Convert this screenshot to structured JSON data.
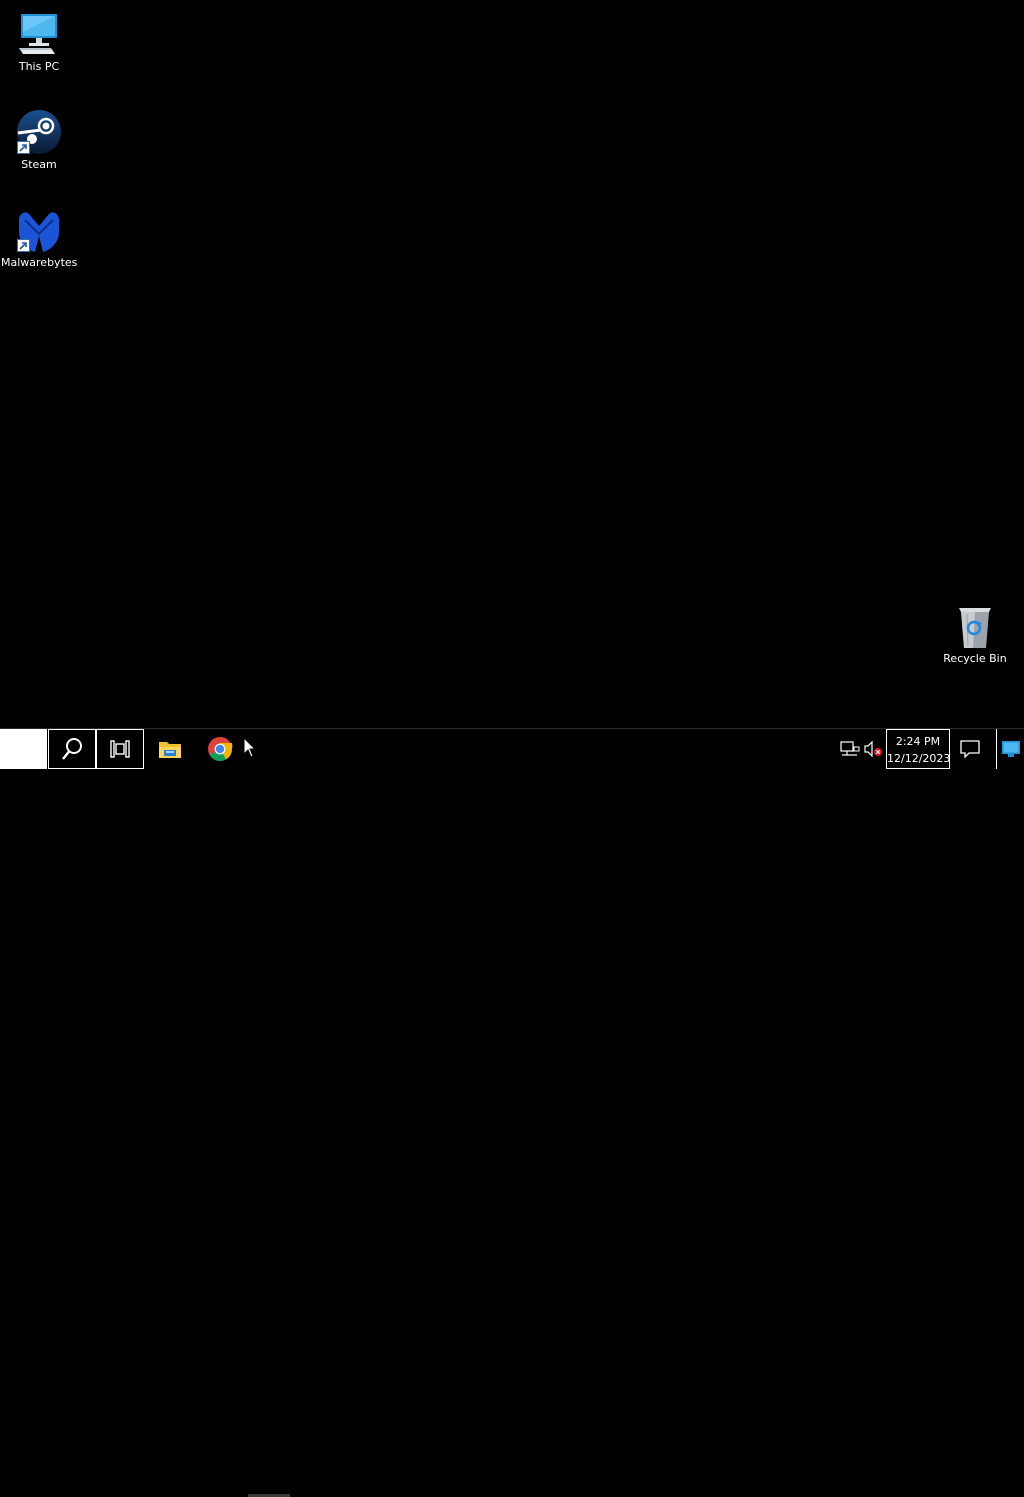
{
  "desktop": {
    "icons": [
      {
        "label": "This PC",
        "icon": "computer-icon"
      },
      {
        "label": "Steam",
        "icon": "steam-icon"
      },
      {
        "label": "Malwarebytes",
        "icon": "malwarebytes-icon"
      },
      {
        "label": "Recycle Bin",
        "icon": "recycle-bin-icon"
      }
    ]
  },
  "taskbar": {
    "apps": [
      {
        "name": "File Explorer",
        "icon": "file-explorer-icon"
      },
      {
        "name": "Google Chrome",
        "icon": "chrome-icon"
      }
    ],
    "tray": {
      "network_icon": "network-icon",
      "volume_icon": "volume-muted-icon"
    },
    "clock": {
      "time": "2:24 PM",
      "date": "12/12/2023"
    }
  },
  "colors": {
    "background": "#000000",
    "accent": "#0078d7"
  }
}
